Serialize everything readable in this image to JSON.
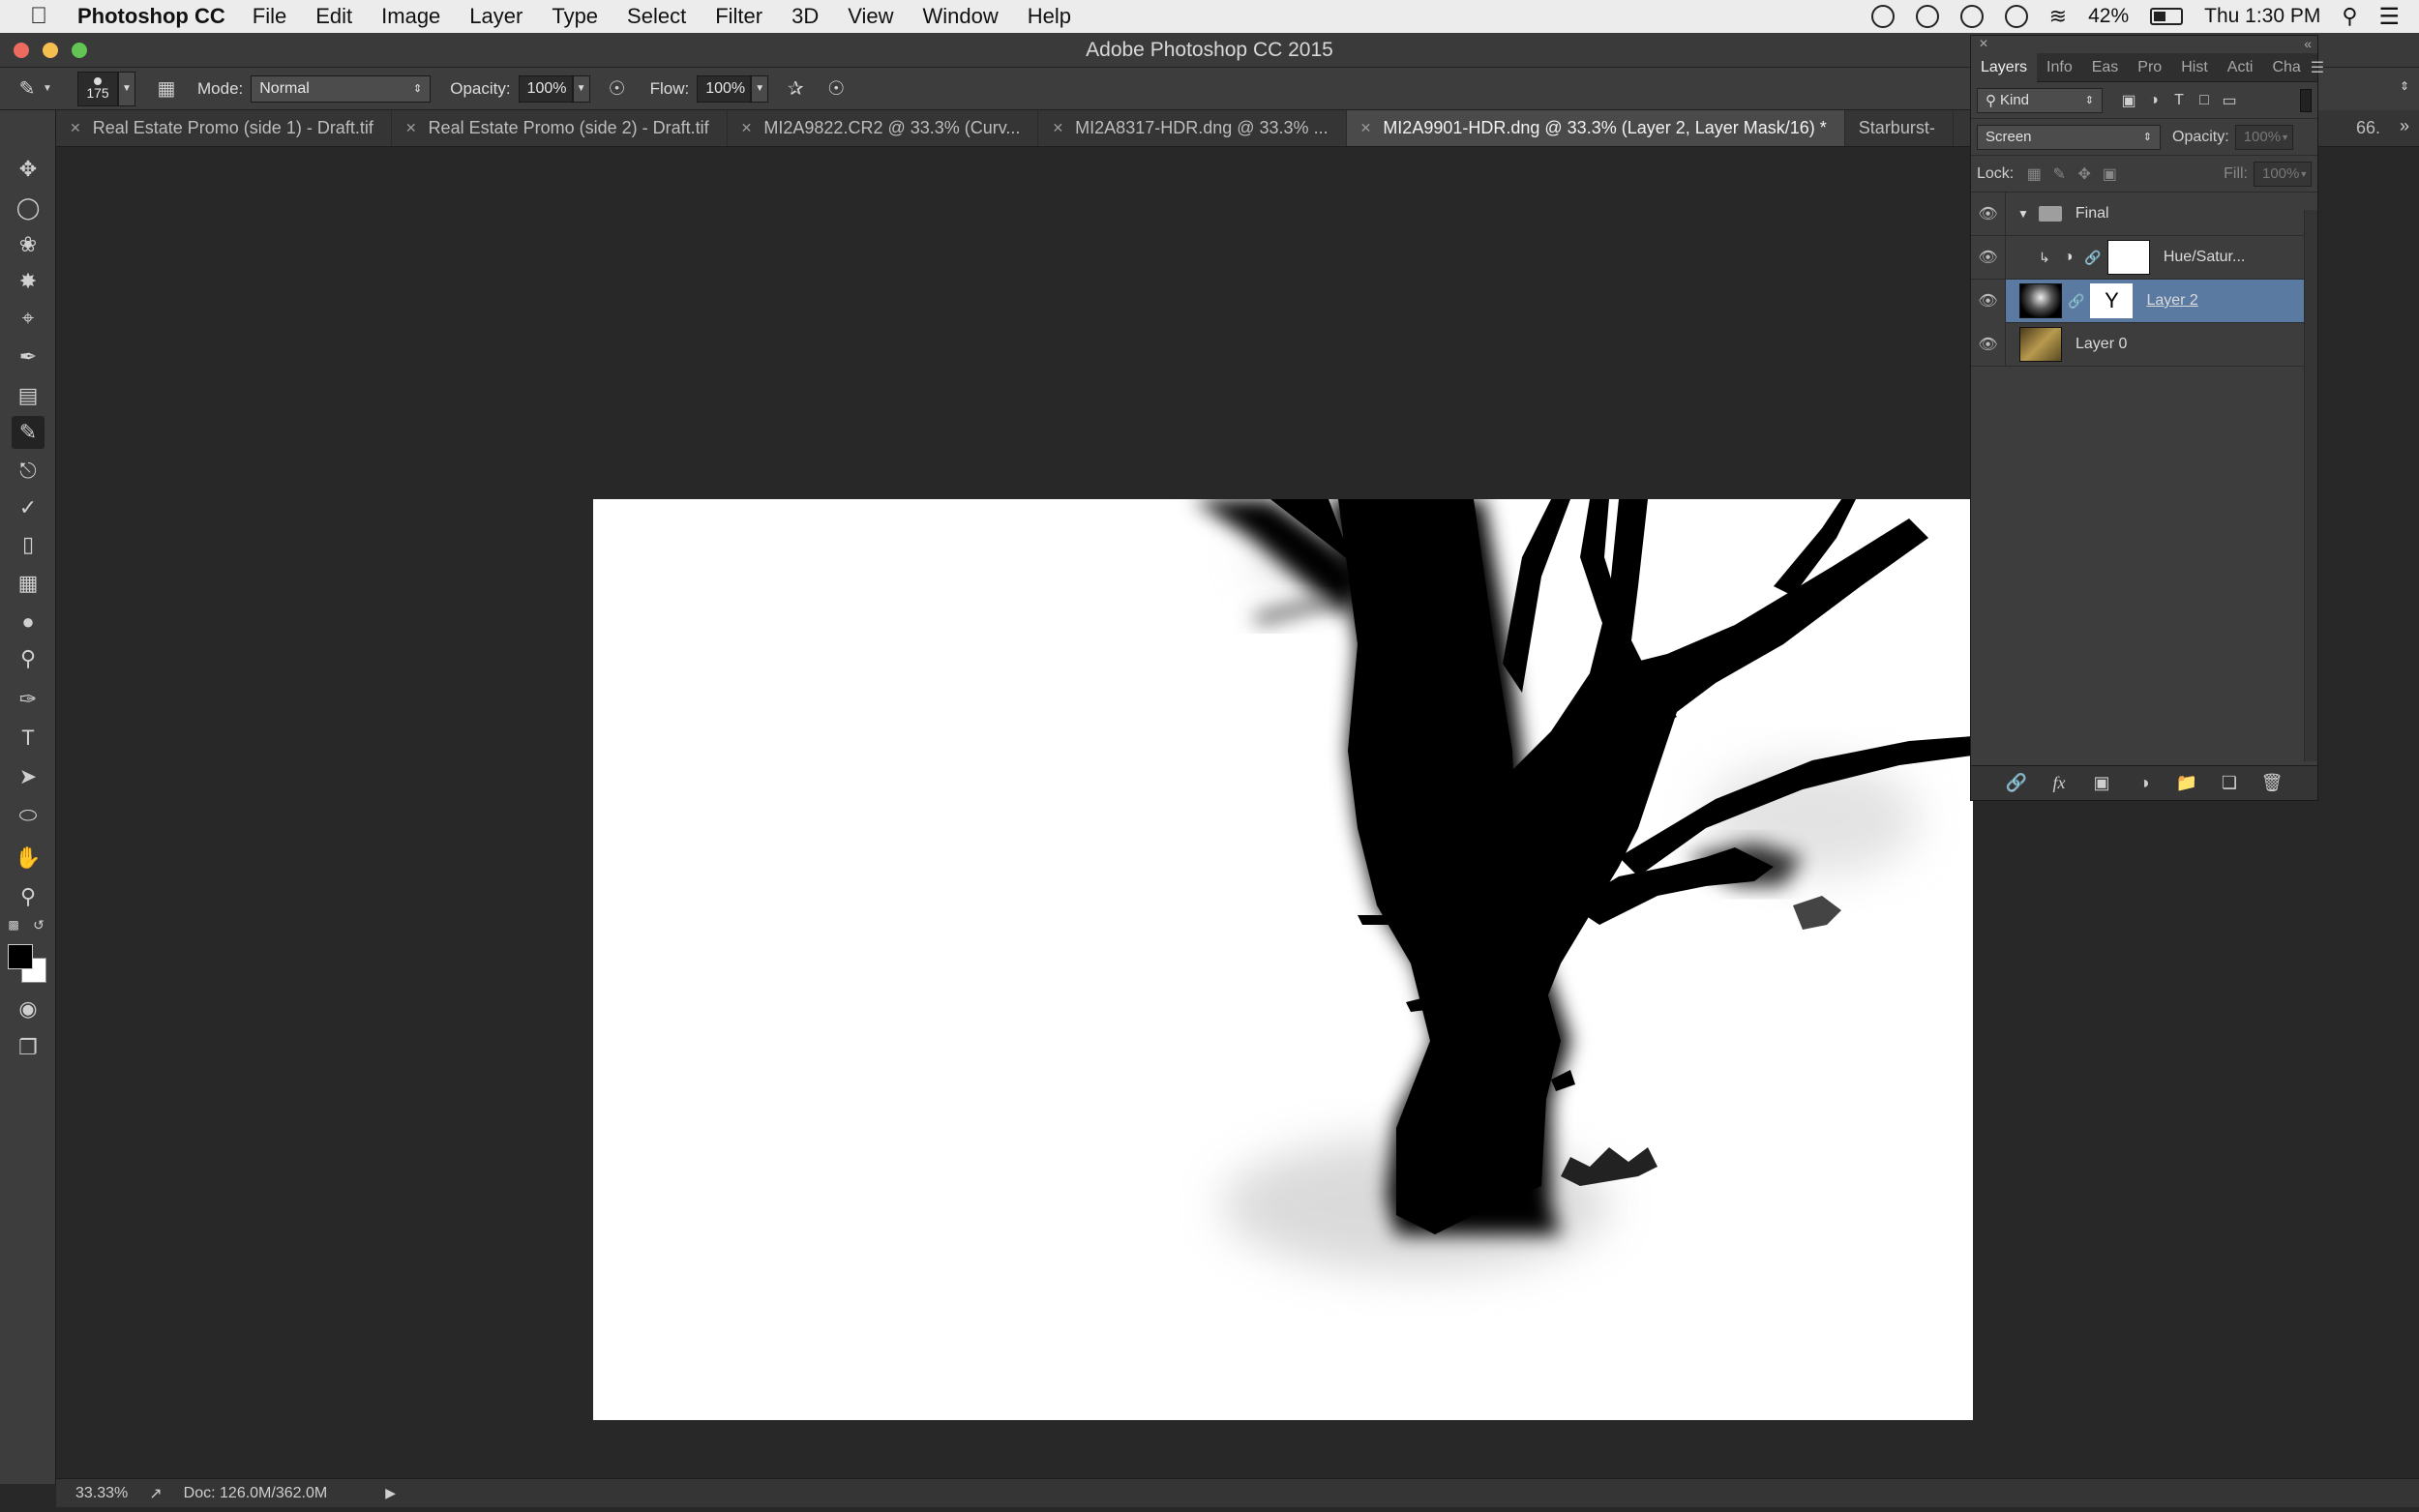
{
  "menubar": {
    "app_name": "Photoshop CC",
    "menus": [
      "File",
      "Edit",
      "Image",
      "Layer",
      "Type",
      "Select",
      "Filter",
      "3D",
      "View",
      "Window",
      "Help"
    ],
    "battery": "42%",
    "clock": "Thu 1:30 PM"
  },
  "window": {
    "title": "Adobe Photoshop CC 2015"
  },
  "options": {
    "brush_size": "175",
    "mode_label": "Mode:",
    "mode_value": "Normal",
    "opacity_label": "Opacity:",
    "opacity_value": "100%",
    "flow_label": "Flow:",
    "flow_value": "100%"
  },
  "tabs": [
    {
      "label": "Real Estate Promo (side 1) - Draft.tif"
    },
    {
      "label": "Real Estate Promo (side 2) - Draft.tif"
    },
    {
      "label": "MI2A9822.CR2 @ 33.3% (Curv..."
    },
    {
      "label": "MI2A8317-HDR.dng @ 33.3% ..."
    },
    {
      "label": "MI2A9901-HDR.dng @ 33.3% (Layer 2, Layer Mask/16) *"
    },
    {
      "label": "Starburst-"
    }
  ],
  "tabs_overflow": "66.",
  "status": {
    "zoom": "33.33%",
    "doc": "Doc: 126.0M/362.0M"
  },
  "layers_panel": {
    "tabs": [
      "Layers",
      "Info",
      "Eas",
      "Pro",
      "Hist",
      "Acti",
      "Cha"
    ],
    "filter_kind": "Kind",
    "blend_mode": "Screen",
    "opacity_label": "Opacity:",
    "opacity_value": "100%",
    "lock_label": "Lock:",
    "fill_label": "Fill:",
    "fill_value": "100%",
    "layers": [
      {
        "name": "Final"
      },
      {
        "name": "Hue/Satur..."
      },
      {
        "name": "Layer 2"
      },
      {
        "name": "Layer 0"
      }
    ]
  },
  "colors": {
    "selected_layer": "#5a7aa2",
    "foreground": "#000000",
    "background": "#ffffff"
  }
}
